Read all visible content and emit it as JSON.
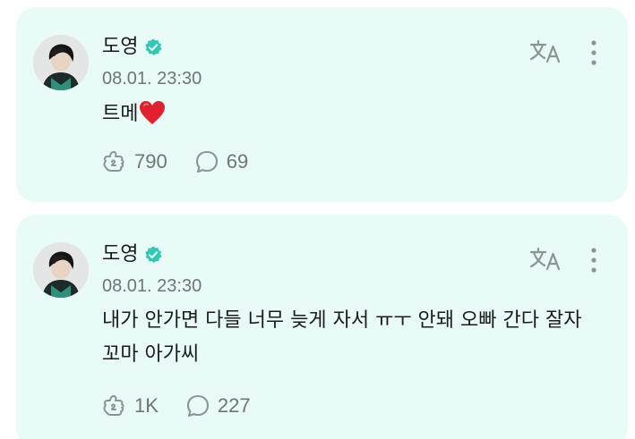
{
  "posts": [
    {
      "author": "도영",
      "timestamp": "08.01. 23:30",
      "text": "트메",
      "likes": "790",
      "comments": "69"
    },
    {
      "author": "도영",
      "timestamp": "08.01. 23:30",
      "text": "내가 안가면 다들 너무 늦게 자서 ㅠㅜ 안돼 오빠 간다 잘자 꼬마 아가씨",
      "likes": "1K",
      "comments": "227"
    }
  ],
  "colors": {
    "card_bg": "#e8fbf7",
    "verified_badge": "#2fc9b5",
    "icon_gray": "#8c9593",
    "heart": "#e0202e"
  },
  "icons": [
    "verified-badge-icon",
    "translate-icon",
    "more-vertical-icon",
    "like-icon",
    "comment-icon",
    "heart-emoji"
  ]
}
